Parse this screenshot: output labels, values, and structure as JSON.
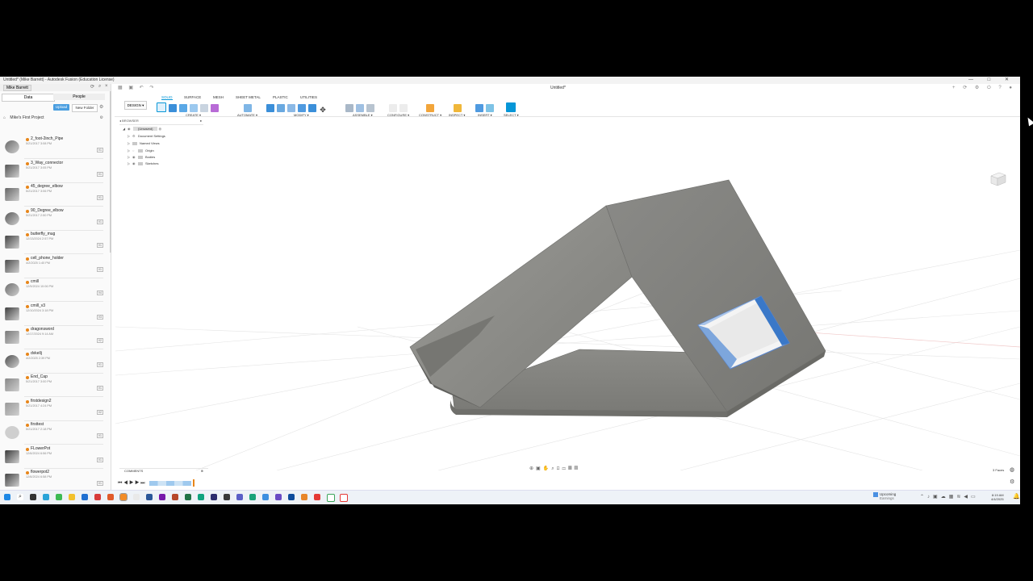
{
  "window": {
    "title": "Untitled* (Mike Barrett) - Autodesk Fusion (Education License)",
    "controls": [
      "—",
      "□",
      "✕"
    ]
  },
  "data_panel": {
    "user": "Mike Barrett",
    "tabs": [
      "Data",
      "People"
    ],
    "upload_label": "Upload",
    "new_folder_label": "New Folder",
    "project": "Mike's First Project",
    "files": [
      {
        "name": "2_foot-2inch_Pipe",
        "date": "5/21/2017 3:08 PM",
        "ver": "V1"
      },
      {
        "name": "3_Way_connector",
        "date": "5/21/2017 3:05 PM",
        "ver": "V1"
      },
      {
        "name": "45_degree_elbow",
        "date": "5/21/2017 3:06 PM",
        "ver": "V1"
      },
      {
        "name": "90_Degree_elbow",
        "date": "5/21/2017 2:50 PM",
        "ver": "V1"
      },
      {
        "name": "butterfly_mug",
        "date": "12/13/2024 2:57 PM",
        "ver": "V1"
      },
      {
        "name": "cell_phone_holder",
        "date": "4/2/2025 1:40 PM",
        "ver": "V1"
      },
      {
        "name": "cmill",
        "date": "12/9/2024 10:06 PM",
        "ver": "V4"
      },
      {
        "name": "cmill_v3",
        "date": "12/10/2024 3:18 PM",
        "ver": "V3"
      },
      {
        "name": "dragonsword",
        "date": "12/17/2024 9:14 AM",
        "ver": "V2"
      },
      {
        "name": "dvkellj",
        "date": "4/2/2025 2:39 PM",
        "ver": "V1"
      },
      {
        "name": "End_Cap",
        "date": "5/21/2017 3:00 PM",
        "ver": "V1"
      },
      {
        "name": "firstdesign2",
        "date": "5/21/2017 4:24 PM",
        "ver": "V2"
      },
      {
        "name": "firsttest",
        "date": "5/21/2017 2:18 PM",
        "ver": "V1"
      },
      {
        "name": "FLowerPot",
        "date": "12/6/2024 6:56 PM",
        "ver": "V1"
      },
      {
        "name": "flowerpot2",
        "date": "12/6/2024 6:58 PM",
        "ver": "V1"
      }
    ]
  },
  "toolbar": {
    "doc_tab": "Untitled*",
    "design_label": "DESIGN ▾",
    "workspace_tabs": [
      "SOLID",
      "SURFACE",
      "MESH",
      "SHEET METAL",
      "PLASTIC",
      "UTILITIES"
    ],
    "active_tab": "SOLID",
    "groups": [
      "CREATE ▾",
      "AUTOMATE ▾",
      "MODIFY ▾",
      "ASSEMBLE ▾",
      "CONFIGURE ▾",
      "CONSTRUCT ▾",
      "INSPECT ▾",
      "INSERT ▾",
      "SELECT ▾"
    ]
  },
  "browser": {
    "header": "BROWSER",
    "root": "(Unsaved)",
    "nodes": [
      "Document Settings",
      "Named Views",
      "Origin",
      "Bodies",
      "Sketches"
    ]
  },
  "comments_label": "COMMENTS",
  "status_right": "3 Faces",
  "taskbar": {
    "weather_title": "Upcoming",
    "weather_sub": "Earnings",
    "time": "8:19 AM",
    "date": "4/4/2025"
  },
  "colors": {
    "accent": "#0696d7",
    "model_face": "#8f8f8c",
    "selected_face": "#3a78c8",
    "grid": "#e4e4e4"
  }
}
